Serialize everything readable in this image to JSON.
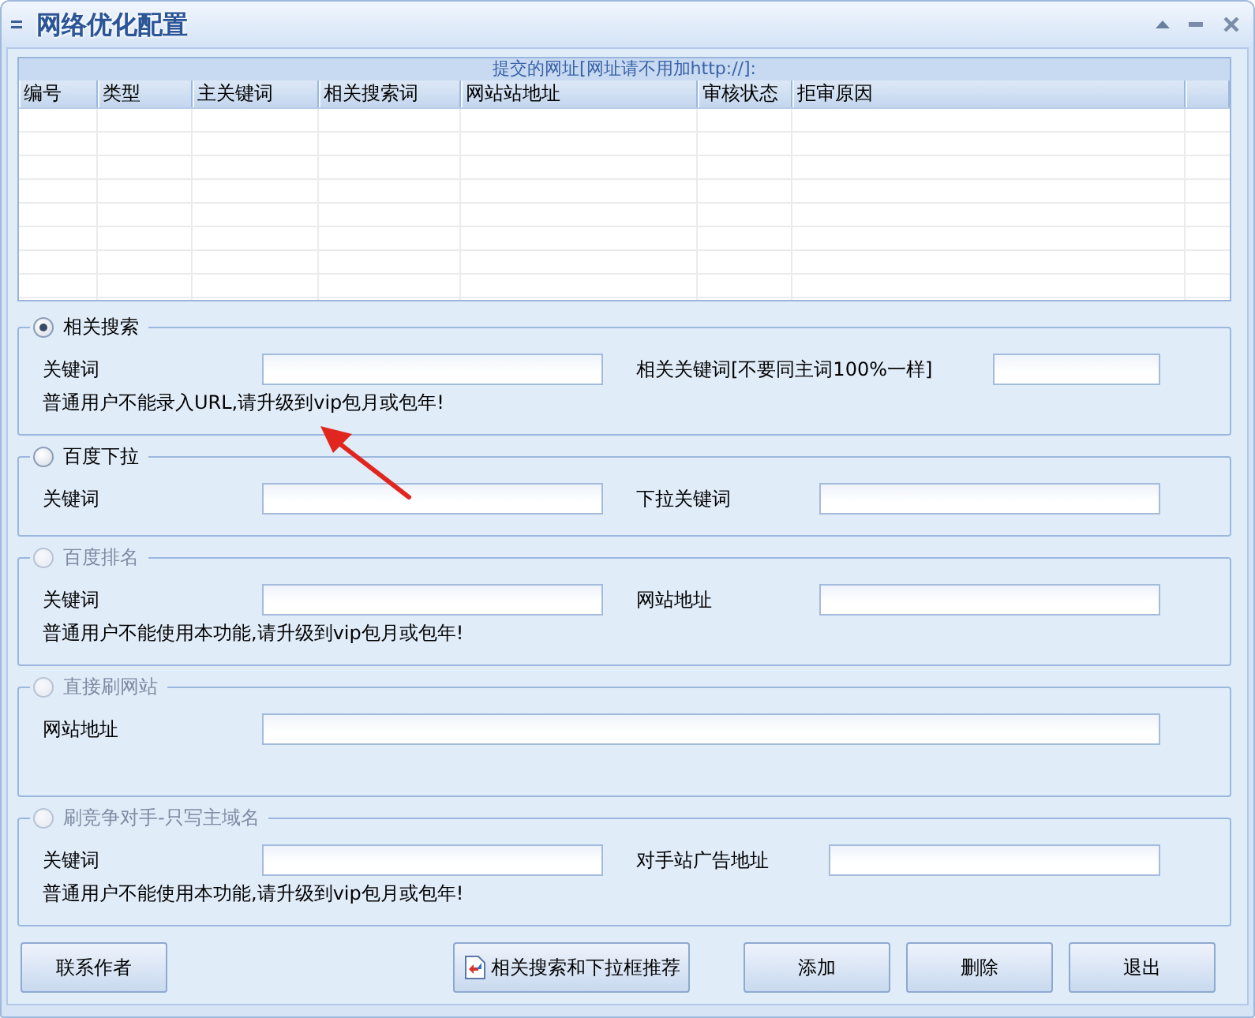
{
  "window": {
    "title": "网络优化配置"
  },
  "table": {
    "caption": "提交的网址[网址请不用加http://]:",
    "columns": [
      "编号",
      "类型",
      "主关键词",
      "相关搜索词",
      "网站站地址",
      "审核状态",
      "拒审原因"
    ]
  },
  "groups": [
    {
      "title": "相关搜索",
      "selected": true,
      "disabled": false,
      "fields": [
        {
          "label": "关键词"
        },
        {
          "label": "相关关键词[不要同主词100%一样]"
        }
      ],
      "note": "普通用户不能录入URL,请升级到vip包月或包年!"
    },
    {
      "title": "百度下拉",
      "selected": false,
      "disabled": false,
      "fields": [
        {
          "label": "关键词"
        },
        {
          "label": "下拉关键词"
        }
      ]
    },
    {
      "title": "百度排名",
      "selected": false,
      "disabled": true,
      "fields": [
        {
          "label": "关键词"
        },
        {
          "label": "网站地址"
        }
      ],
      "note": "普通用户不能使用本功能,请升级到vip包月或包年!"
    },
    {
      "title": "直接刷网站",
      "selected": false,
      "disabled": true,
      "fields": [
        {
          "label": "网站地址"
        }
      ]
    },
    {
      "title": "刷竞争对手-只写主域名",
      "selected": false,
      "disabled": true,
      "fields": [
        {
          "label": "关键词"
        },
        {
          "label": "对手站广告地址"
        }
      ],
      "note": "普通用户不能使用本功能,请升级到vip包月或包年!"
    }
  ],
  "buttons": [
    {
      "label": "联系作者",
      "kind": "text"
    },
    {
      "label": "相关搜索和下拉框推荐",
      "kind": "icon_text"
    },
    {
      "label": "添加",
      "kind": "text"
    },
    {
      "label": "删除",
      "kind": "text"
    },
    {
      "label": "退出",
      "kind": "text"
    }
  ]
}
